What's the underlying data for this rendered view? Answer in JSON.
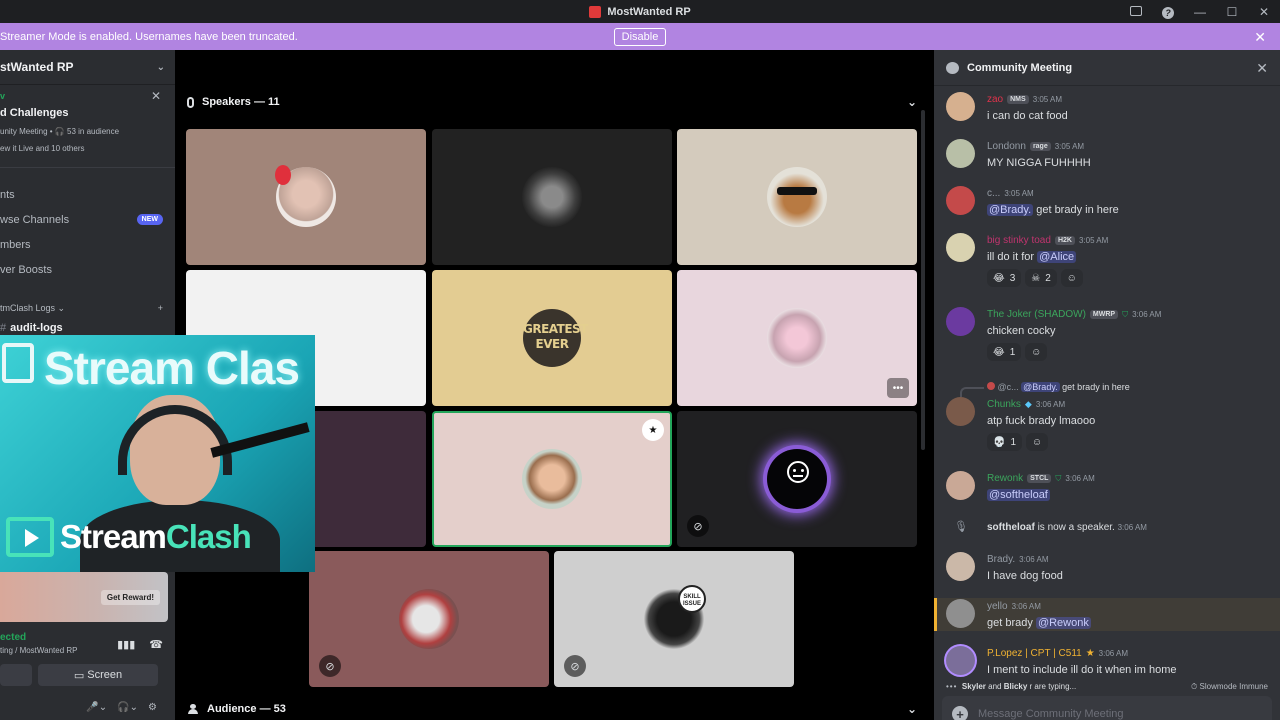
{
  "window": {
    "title": "MostWanted RP"
  },
  "banner": {
    "message": "Streamer Mode is enabled. Usernames have been truncated.",
    "button": "Disable"
  },
  "sidebar": {
    "server_name": "stWanted RP",
    "event": {
      "tag": "v",
      "title": "d Challenges",
      "meta": "unity Meeting • 🎧 53 in audience",
      "sub": "ew it Live and 10 others"
    },
    "items": [
      {
        "label": "nts",
        "badge": ""
      },
      {
        "label": "wse Channels",
        "badge": "NEW"
      },
      {
        "label": "mbers",
        "badge": ""
      },
      {
        "label": "ver Boosts",
        "badge": ""
      }
    ],
    "category": "tmClash Logs",
    "channel": "audit-logs",
    "reward_button": "Get Reward!",
    "voice_status": "ected",
    "voice_location": "ting / MostWanted RP",
    "screen_button": "Screen"
  },
  "stage": {
    "speakers_label": "Speakers — 11",
    "audience_label": "Audience — 53",
    "greatest_text": "GREATEST EVER"
  },
  "webcam": {
    "top_text": "Stream Clas",
    "brand1": "Stream",
    "brand2": "Clash"
  },
  "chat": {
    "title": "Community Meeting",
    "messages": [
      {
        "name": "zao",
        "tag": "NMS",
        "time": "3:05 AM",
        "text": "i can do cat food",
        "color": "#e0334b"
      },
      {
        "name": "Londonn",
        "tag": "rage",
        "time": "3:05 AM",
        "text": "MY NIGGA FUHHHH",
        "color": "#949ba4"
      },
      {
        "name": "c...",
        "time": "3:05 AM",
        "mention": "@Brady.",
        "text": "get brady in here",
        "color": "#949ba4"
      },
      {
        "name": "big stinky toad",
        "tag": "H2K",
        "time": "3:05 AM",
        "text": "ill do it for",
        "mention": "@Alice",
        "color": "#c0346e",
        "reacts": [
          {
            "emoji": "😂",
            "count": "3"
          },
          {
            "emoji": "☠",
            "count": "2"
          }
        ]
      },
      {
        "name": "The Joker (SHADOW)",
        "tag": "MWRP",
        "time": "3:06 AM",
        "text": "chicken cocky",
        "color": "#3ba55c",
        "reacts": [
          {
            "emoji": "😂",
            "count": "1"
          }
        ]
      },
      {
        "reply_user": "@c...",
        "reply_mention": "@Brady.",
        "reply_text": "get brady in here",
        "name": "Chunks",
        "time": "3:06 AM",
        "text": "atp fuck brady lmaooo",
        "color": "#3ba55c",
        "reacts": [
          {
            "emoji": "💀",
            "count": "1"
          }
        ]
      },
      {
        "name": "Rewonk",
        "tag": "STCL",
        "time": "3:06 AM",
        "mention": "@softheloaf",
        "color": "#3ba55c"
      },
      {
        "system_user": "softheloaf",
        "system_text": "is now a speaker.",
        "time": "3:06 AM"
      },
      {
        "name": "Brady.",
        "time": "3:06 AM",
        "text": "I have dog food",
        "color": "#949ba4"
      },
      {
        "name": "yello",
        "time": "3:06 AM",
        "text": "get brady",
        "mention": "@Rewonk",
        "color": "#949ba4"
      },
      {
        "name": "P.Lopez | CPT | C511",
        "time": "3:06 AM",
        "text": "I ment to include ill do it when im home",
        "color": "#f0b232"
      }
    ],
    "typing": {
      "user1": "Skyler",
      "and": "and",
      "user2": "Blicky",
      "rest": "r are typing...",
      "slowmode": "Slowmode Immune"
    },
    "composer_placeholder": "Message Community Meeting"
  },
  "colors": {
    "banner": "#b184e1",
    "accent": "#5865f2",
    "online": "#23a55a"
  }
}
